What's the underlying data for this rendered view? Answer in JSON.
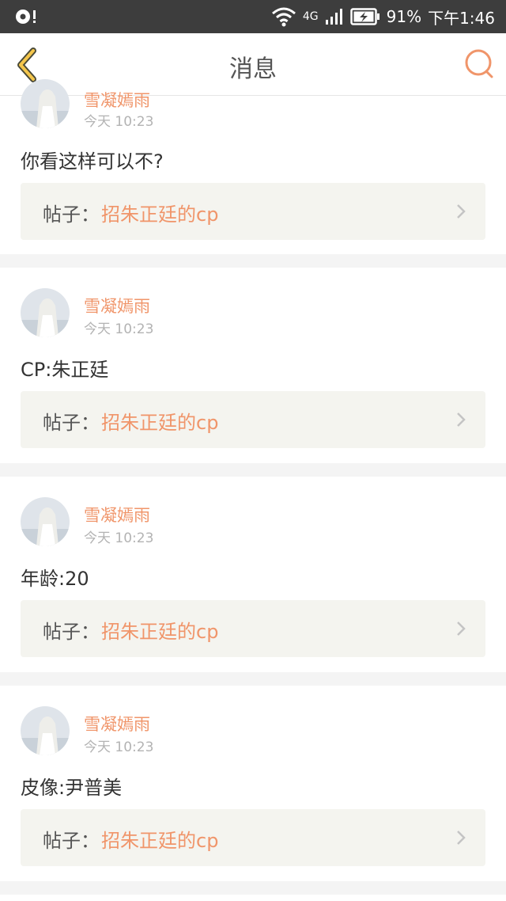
{
  "status_bar": {
    "network": "4G",
    "battery_percent": "91%",
    "time": "下午1:46"
  },
  "header": {
    "title": "消息",
    "accent_color": "#f0956a"
  },
  "posts_prefix": "帖子：",
  "items": [
    {
      "username": "雪凝嫣雨",
      "time": "今天 10:23",
      "message": "你看这样可以不?",
      "post_title": "招朱正廷的cp"
    },
    {
      "username": "雪凝嫣雨",
      "time": "今天 10:23",
      "message": "CP:朱正廷",
      "post_title": "招朱正廷的cp"
    },
    {
      "username": "雪凝嫣雨",
      "time": "今天 10:23",
      "message": "年龄:20",
      "post_title": "招朱正廷的cp"
    },
    {
      "username": "雪凝嫣雨",
      "time": "今天 10:23",
      "message": "皮像:尹普美",
      "post_title": "招朱正廷的cp"
    }
  ]
}
